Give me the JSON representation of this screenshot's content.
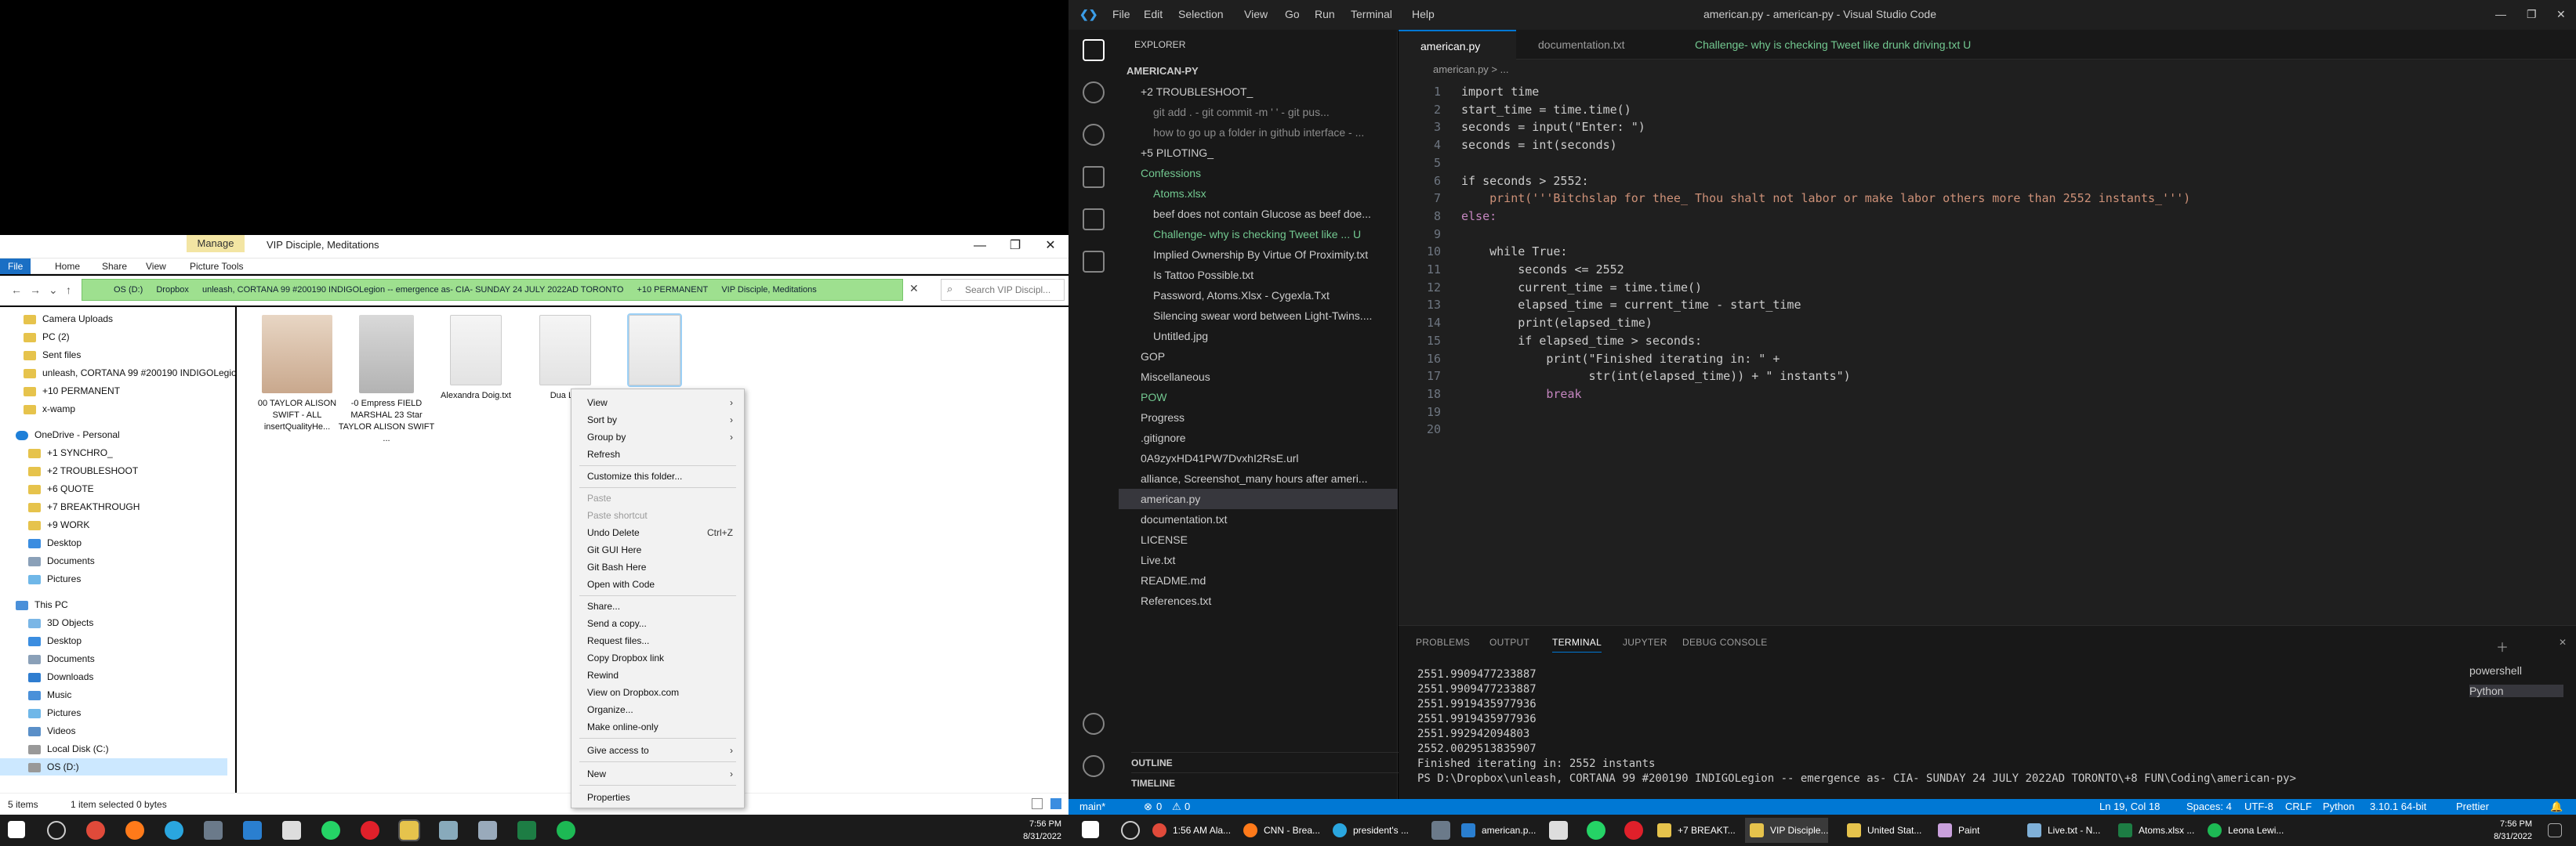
{
  "explorer": {
    "manage_tab": "Manage",
    "title": "VIP Disciple, Meditations",
    "ribbon_tabs": [
      "File",
      "Home",
      "Share",
      "View",
      "Picture Tools"
    ],
    "path": [
      "OS (D:)",
      "Dropbox",
      "unleash, CORTANA 99 #200190 INDIGOLegion -- emergence as- CIA- SUNDAY 24 JULY 2022AD TORONTO",
      "+10 PERMANENT",
      "VIP Disciple, Meditations"
    ],
    "search_placeholder": "Search VIP Discipl...",
    "nav_items": [
      "Camera Uploads",
      "PC (2)",
      "Sent files",
      "unleash, CORTANA 99 #200190 INDIGOLegion",
      "+10 PERMANENT",
      "x-wamp",
      "OneDrive - Personal",
      "+1 SYNCHRO_",
      "+2 TROUBLESHOOT",
      "+6 QUOTE",
      "+7 BREAKTHROUGH",
      "+9 WORK",
      "Desktop",
      "Documents",
      "Pictures",
      "This PC",
      "3D Objects",
      "Desktop",
      "Documents",
      "Downloads",
      "Music",
      "Pictures",
      "Videos",
      "Local Disk (C:)",
      "OS (D:)"
    ],
    "files": [
      {
        "name": "00 TAYLOR ALISON SWIFT - ALL insertQualityHe..."
      },
      {
        "name": "-0 Empress FIELD MARSHAL 23 Star TAYLOR ALISON SWIFT ..."
      },
      {
        "name": "Alexandra Doig.txt"
      },
      {
        "name": "Dua L..."
      },
      {
        "name": ""
      }
    ],
    "status_items": "5 items",
    "status_selected": "1 item selected  0 bytes"
  },
  "context_menu": {
    "items": [
      "View",
      "Sort by",
      "Group by",
      "Refresh",
      "Customize this folder...",
      "Paste",
      "Paste shortcut",
      "Undo Delete",
      "Git GUI Here",
      "Git Bash Here",
      "Open with Code",
      "Share...",
      "Send a copy...",
      "Request files...",
      "Copy Dropbox link",
      "Rewind",
      "View on Dropbox.com",
      "Organize...",
      "Make online-only",
      "Give access to",
      "New",
      "Properties"
    ],
    "undo_shortcut": "Ctrl+Z"
  },
  "vscode": {
    "menus": [
      "File",
      "Edit",
      "Selection",
      "View",
      "Go",
      "Run",
      "Terminal",
      "Help"
    ],
    "window_title": "american.py - american-py - Visual Studio Code",
    "explorer_header": "EXPLORER",
    "root_folder": "AMERICAN-PY",
    "tree": [
      "+2 TROUBLESHOOT_",
      "git add . - git commit -m '           ' - git pus...",
      "how to go up a folder in github interface - ...",
      "+5 PILOTING_",
      "Confessions",
      "Atoms.xlsx",
      "beef does not contain Glucose as beef doe...",
      "Challenge- why is checking Tweet like ...  U",
      "Implied Ownership By Virtue Of Proximity.txt",
      "Is Tattoo Possible.txt",
      "Password, Atoms.Xlsx - Cygexla.Txt",
      "Silencing swear word between Light-Twins....",
      "Untitled.jpg",
      "GOP",
      "Miscellaneous",
      "POW",
      "Progress",
      ".gitignore",
      "0A9zyxHD41PW7DvxhI2RsE.url",
      "alliance, Screenshot_many hours after ameri...",
      "american.py",
      "documentation.txt",
      "LICENSE",
      "Live.txt",
      "README.md",
      "References.txt"
    ],
    "outline": "OUTLINE",
    "timeline": "TIMELINE",
    "tabs": [
      "american.py",
      "documentation.txt",
      "Challenge- why is checking Tweet like drunk driving.txt  U"
    ],
    "breadcrumb": "american.py > ...",
    "code_lines": [
      "import time",
      "",
      "start_time = time.time()",
      "seconds = input(\"Enter: \")",
      "seconds = int(seconds)",
      "",
      "if seconds > 2552:",
      "    print('''Bitchslap for thee_ Thou shalt not labor or make labor others more than 2552 instants_''')",
      "else:",
      "",
      "    while True:",
      "        seconds <= 2552",
      "        current_time = time.time()",
      "        elapsed_time = current_time - start_time",
      "        print(elapsed_time)",
      "        if elapsed_time > seconds:",
      "            print(\"Finished iterating in: \" +",
      "                  str(int(elapsed_time)) + \" instants\")",
      "            break",
      ""
    ],
    "panel_tabs": [
      "PROBLEMS",
      "OUTPUT",
      "TERMINAL",
      "JUPYTER",
      "DEBUG CONSOLE"
    ],
    "terminal_lines": [
      "2551.9909477233887",
      "2551.9909477233887",
      "2551.9919435977936",
      "2551.9919435977936",
      "2551.992942094803",
      "2552.0029513835907",
      "Finished iterating in: 2552 instants",
      "PS D:\\Dropbox\\unleash, CORTANA 99 #200190 INDIGOLegion -- emergence as- CIA- SUNDAY 24 JULY 2022AD TORONTO\\+8 FUN\\Coding\\american-py> "
    ],
    "terminals": [
      "powershell",
      "Python"
    ],
    "status": {
      "branch": "main*",
      "sync": "",
      "errors": "0",
      "warnings": "0",
      "position": "Ln 19, Col 18",
      "spaces": "Spaces: 4",
      "encoding": "UTF-8",
      "eol": "CRLF",
      "language": "Python",
      "interpreter": "3.10.1 64-bit",
      "prettier": "Prettier"
    }
  },
  "taskbar": {
    "items": [
      "1:56 AM Ala...",
      "CNN - Brea...",
      "president's ...",
      "american.p...",
      "+7 BREAKT...",
      "VIP Disciple...",
      "United Stat...",
      "Paint",
      "Live.txt - N...",
      "Atoms.xlsx ...",
      "Leona Lewi..."
    ],
    "time": "7:56 PM",
    "date": "8/31/2022"
  },
  "colors": {
    "accent": "#0078d4",
    "path_bar": "#9ee08f",
    "manage_tab": "#f3e5a3"
  }
}
